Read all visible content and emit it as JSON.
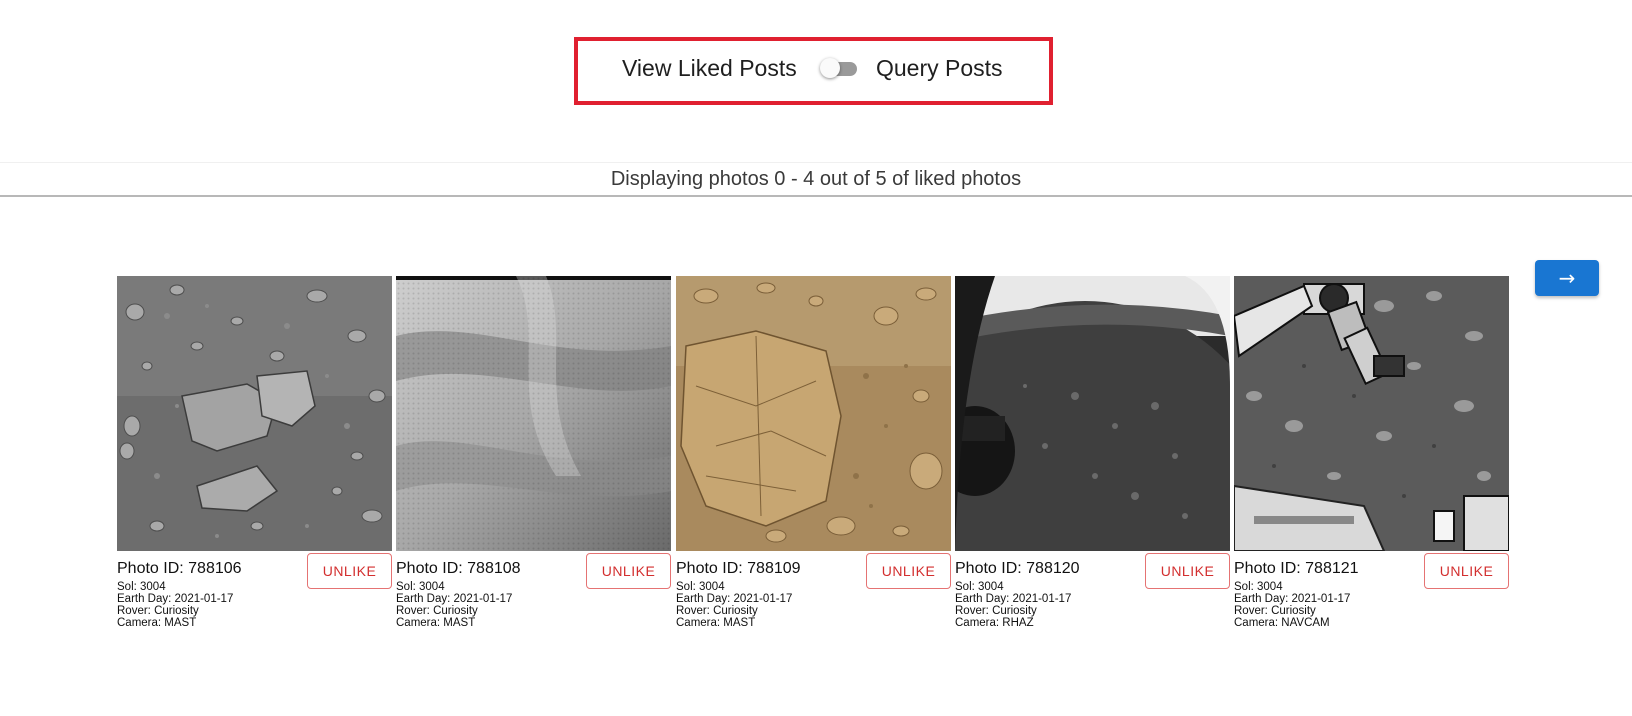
{
  "toggle": {
    "left_label": "View Liked Posts",
    "right_label": "Query Posts",
    "checked": false
  },
  "status": {
    "text": "Displaying photos 0 - 4 out of 5 of liked photos"
  },
  "navigation": {
    "next_label": "→"
  },
  "colors": {
    "highlight_border": "#e02030",
    "accent": "#1976d2",
    "unlike": "#d32f2f"
  },
  "photos": [
    {
      "id_label": "Photo ID: 788106",
      "unlike_label": "UNLIKE",
      "sol": "Sol: 3004",
      "earth_day": "Earth Day: 2021-01-17",
      "rover": "Rover: Curiosity",
      "camera": "Camera: MAST",
      "image": "grey-rocky-terrain"
    },
    {
      "id_label": "Photo ID: 788108",
      "unlike_label": "UNLIKE",
      "sol": "Sol: 3004",
      "earth_day": "Earth Day: 2021-01-17",
      "rover": "Rover: Curiosity",
      "camera": "Camera: MAST",
      "image": "blurred-grey-closeup"
    },
    {
      "id_label": "Photo ID: 788109",
      "unlike_label": "UNLIKE",
      "sol": "Sol: 3004",
      "earth_day": "Earth Day: 2021-01-17",
      "rover": "Rover: Curiosity",
      "camera": "Camera: MAST",
      "image": "tan-martian-rock"
    },
    {
      "id_label": "Photo ID: 788120",
      "unlike_label": "UNLIKE",
      "sol": "Sol: 3004",
      "earth_day": "Earth Day: 2021-01-17",
      "rover": "Rover: Curiosity",
      "camera": "Camera: RHAZ",
      "image": "fisheye-hazcam-ground"
    },
    {
      "id_label": "Photo ID: 788121",
      "unlike_label": "UNLIKE",
      "sol": "Sol: 3004",
      "earth_day": "Earth Day: 2021-01-17",
      "rover": "Rover: Curiosity",
      "camera": "Camera: NAVCAM",
      "image": "rover-arm-terrain"
    }
  ]
}
